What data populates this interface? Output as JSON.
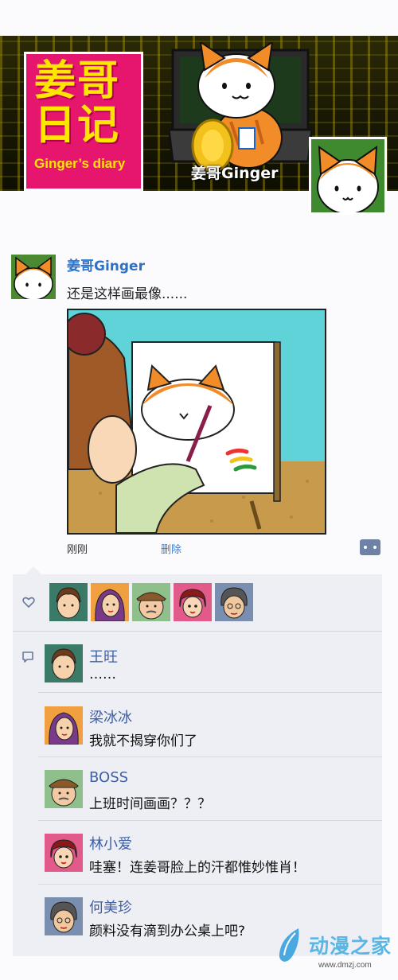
{
  "banner": {
    "title_line1": "姜哥",
    "title_line2": "日记",
    "subtitle": "Ginger’s diary",
    "name": "姜哥Ginger",
    "colors": {
      "title_bg": "#e6166f",
      "title_text": "#ffe600"
    }
  },
  "post": {
    "author": "姜哥Ginger",
    "text": "还是这样画最像......",
    "time": "刚刚",
    "delete_label": "删除",
    "image_icon": "cat-painting-illustration"
  },
  "likes": {
    "icon": "heart-icon",
    "avatars": [
      "avatar-wangwang",
      "avatar-liangbingbing",
      "avatar-boss",
      "avatar-linxiaoai",
      "avatar-hemeizhen"
    ]
  },
  "comments": [
    {
      "name": "王旺",
      "text": "……"
    },
    {
      "name": "梁冰冰",
      "text": "我就不揭穿你们了"
    },
    {
      "name": "BOSS",
      "text": "上班时间画画？？？"
    },
    {
      "name": "林小爱",
      "text": "哇塞！连姜哥脸上的汗都惟妙惟肖！"
    },
    {
      "name": "何美珍",
      "text": "颜料没有滴到办公桌上吧?"
    }
  ],
  "watermark": {
    "text": "动漫之家",
    "url": "www.dmzj.com"
  },
  "colors": {
    "link": "#2b72c8",
    "comment_name": "#3f5fa3",
    "panel_bg": "#eeeff5"
  }
}
